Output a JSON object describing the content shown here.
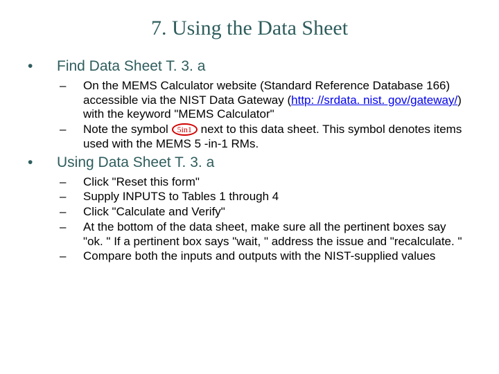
{
  "title": "7.  Using the Data Sheet",
  "section1": {
    "bullet": "•",
    "heading": "Find Data Sheet T. 3. a",
    "items": [
      {
        "dash": "–",
        "pre": "On the MEMS Calculator website (Standard Reference Database 166) accessible via the NIST Data Gateway (",
        "link": "http: //srdata. nist. gov/gateway/",
        "post": ") with the keyword \"MEMS Calculator\""
      },
      {
        "dash": "–",
        "pre": "Note the symbol ",
        "ellipse": "5in1",
        "post": " next to this data sheet.  This symbol denotes items used with the MEMS 5 -in-1 RMs."
      }
    ]
  },
  "section2": {
    "bullet": "•",
    "heading": "Using Data Sheet T. 3. a",
    "items": [
      {
        "dash": "–",
        "text": "Click \"Reset this form\""
      },
      {
        "dash": "–",
        "text": "Supply INPUTS to Tables 1 through 4"
      },
      {
        "dash": "–",
        "text": "Click \"Calculate and Verify\""
      },
      {
        "dash": "–",
        "text": "At the bottom of the data sheet, make sure all the pertinent boxes say \"ok. \"  If a pertinent box says \"wait, \" address the issue and \"recalculate. \""
      },
      {
        "dash": "–",
        "text": "Compare both the inputs and outputs with the NIST-supplied values"
      }
    ]
  }
}
